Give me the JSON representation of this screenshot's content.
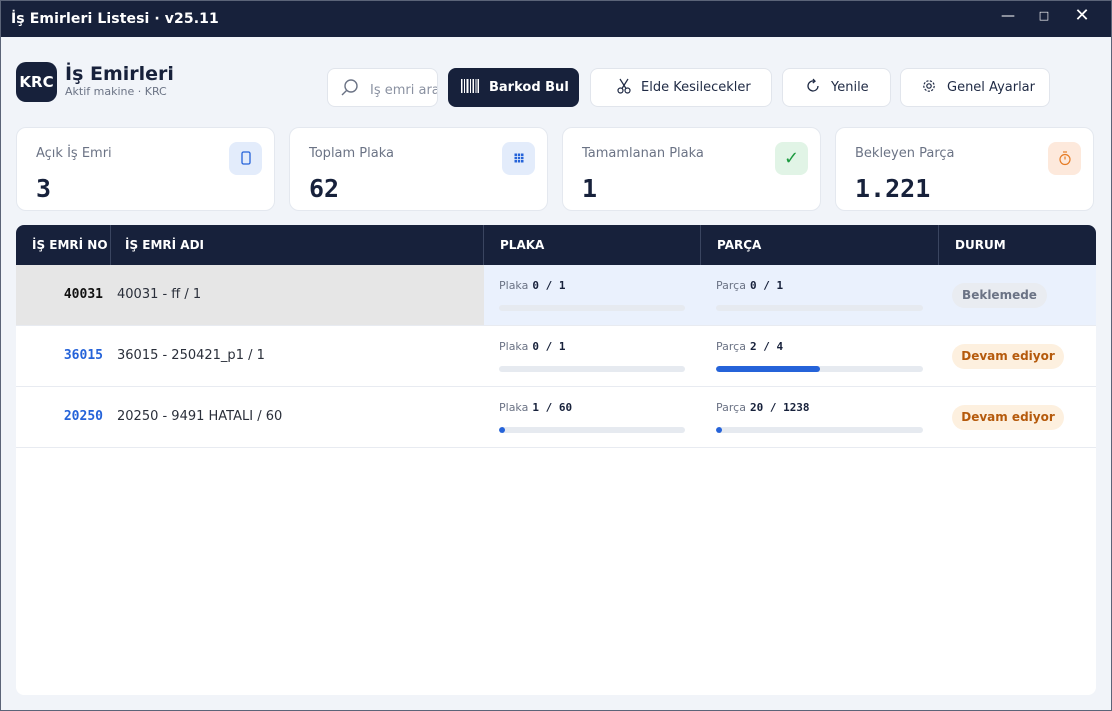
{
  "window": {
    "title": "İş Emirleri Listesi · v25.11",
    "min": "—",
    "max": "□",
    "close": "✕"
  },
  "header": {
    "logo": "KRC",
    "title": "İş Emirleri",
    "subtitle": "Aktif makine · KRC"
  },
  "search": {
    "placeholder": "İş emri ara"
  },
  "toolbar": {
    "barkod_label": "Barkod Bul",
    "elde_label": "Elde Kesilecekler",
    "yenile_label": "Yenile",
    "ayar_label": "Genel Ayarlar"
  },
  "cards": [
    {
      "label": "Açık İş Emri",
      "value": "3",
      "icon": "tablet-icon",
      "color": "#2563d9",
      "bg": "#e3ecfb"
    },
    {
      "label": "Toplam Plaka",
      "value": "62",
      "icon": "grid-icon",
      "color": "#2563d9",
      "bg": "#e3ecfb"
    },
    {
      "label": "Tamamlanan Plaka",
      "value": "1",
      "icon": "check-icon",
      "color": "#1c9a3f",
      "bg": "#e1f4e6"
    },
    {
      "label": "Bekleyen Parça",
      "value": "1.221",
      "icon": "stopwatch-icon",
      "color": "#e67c25",
      "bg": "#fde9dc"
    }
  ],
  "table": {
    "headers": {
      "no": "İŞ EMRİ NO",
      "ad": "İŞ EMRİ ADI",
      "plaka": "PLAKA",
      "parca": "PARÇA",
      "durum": "DURUM"
    },
    "metric_labels": {
      "plaka": "Plaka",
      "parca": "Parça"
    },
    "rows": [
      {
        "no": "40031",
        "ad": "40031 - ff / 1",
        "plaka_text": "0 / 1",
        "plaka_pct": 0,
        "parca_text": "0 / 1",
        "parca_pct": 0,
        "durum": "Beklemede",
        "durum_type": "wait",
        "selected": true
      },
      {
        "no": "36015",
        "ad": "36015 - 250421_p1 / 1",
        "plaka_text": "0 / 1",
        "plaka_pct": 0,
        "parca_text": "2 / 4",
        "parca_pct": 50,
        "durum": "Devam ediyor",
        "durum_type": "prog",
        "selected": false
      },
      {
        "no": "20250",
        "ad": "20250 - 9491 HATALI / 60",
        "plaka_text": "1 / 60",
        "plaka_pct": 1.67,
        "parca_text": "20 / 1238",
        "parca_pct": 1.6,
        "durum": "Devam ediyor",
        "durum_type": "prog",
        "selected": false
      }
    ]
  }
}
